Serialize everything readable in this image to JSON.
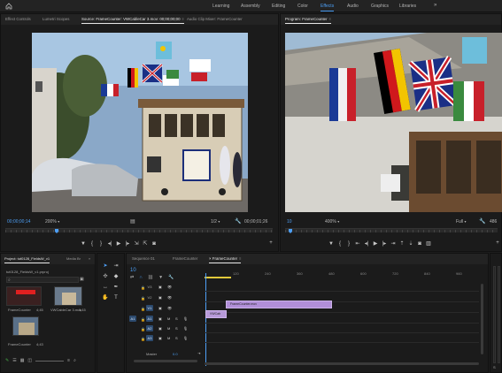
{
  "workspaces": {
    "items": [
      "Learning",
      "Assembly",
      "Editing",
      "Color",
      "Effects",
      "Audio",
      "Graphics",
      "Libraries"
    ],
    "active": "Effects",
    "more": "»"
  },
  "source_panel": {
    "tabs": [
      "Effect Controls",
      "Lumetri Scopes",
      "Source: FrameCounter: VWCableCar 3.mov: 00;00;00;00",
      "Audio Clip Mixer: FrameCounter"
    ],
    "active_tab": "Source: FrameCounter: VWCableCar 3.mov: 00;00;00;00",
    "timecode_in": "00;00;00;14",
    "zoom": "200%",
    "resolution": "1/2",
    "timecode_out": "00;00;01;26"
  },
  "program_panel": {
    "tab": "Program: FrameCounter",
    "timecode": "10",
    "zoom": "400%",
    "resolution": "Full",
    "duration": "486"
  },
  "project_panel": {
    "tabs": [
      "Project: tut0128_FieldsW_v1",
      "Media Br"
    ],
    "file": "tut0128_FieldsW_v1.prproj",
    "items": [
      {
        "name": "FrameCounter",
        "count": "4;45"
      },
      {
        "name": "VWCableCar 3.mov",
        "count": "1;15"
      },
      {
        "name": "FrameCounter",
        "count": "4;43"
      }
    ]
  },
  "timeline": {
    "tabs": [
      "Sequence 01",
      "FrameCounter",
      "FrameCounter"
    ],
    "active_tab": "FrameCounter",
    "timecode": "10",
    "ruler": [
      "120",
      "240",
      "360",
      "480",
      "600",
      "720",
      "840",
      "960"
    ],
    "video_tracks": [
      "V3",
      "V2",
      "V1"
    ],
    "audio_tracks": [
      "A1",
      "A2",
      "A3"
    ],
    "master_label": "Master",
    "master_value": "0.0",
    "clips": [
      {
        "label": "FrameCounter.mov",
        "track": "V2"
      },
      {
        "label": "VWCab",
        "track": "V1"
      }
    ]
  }
}
